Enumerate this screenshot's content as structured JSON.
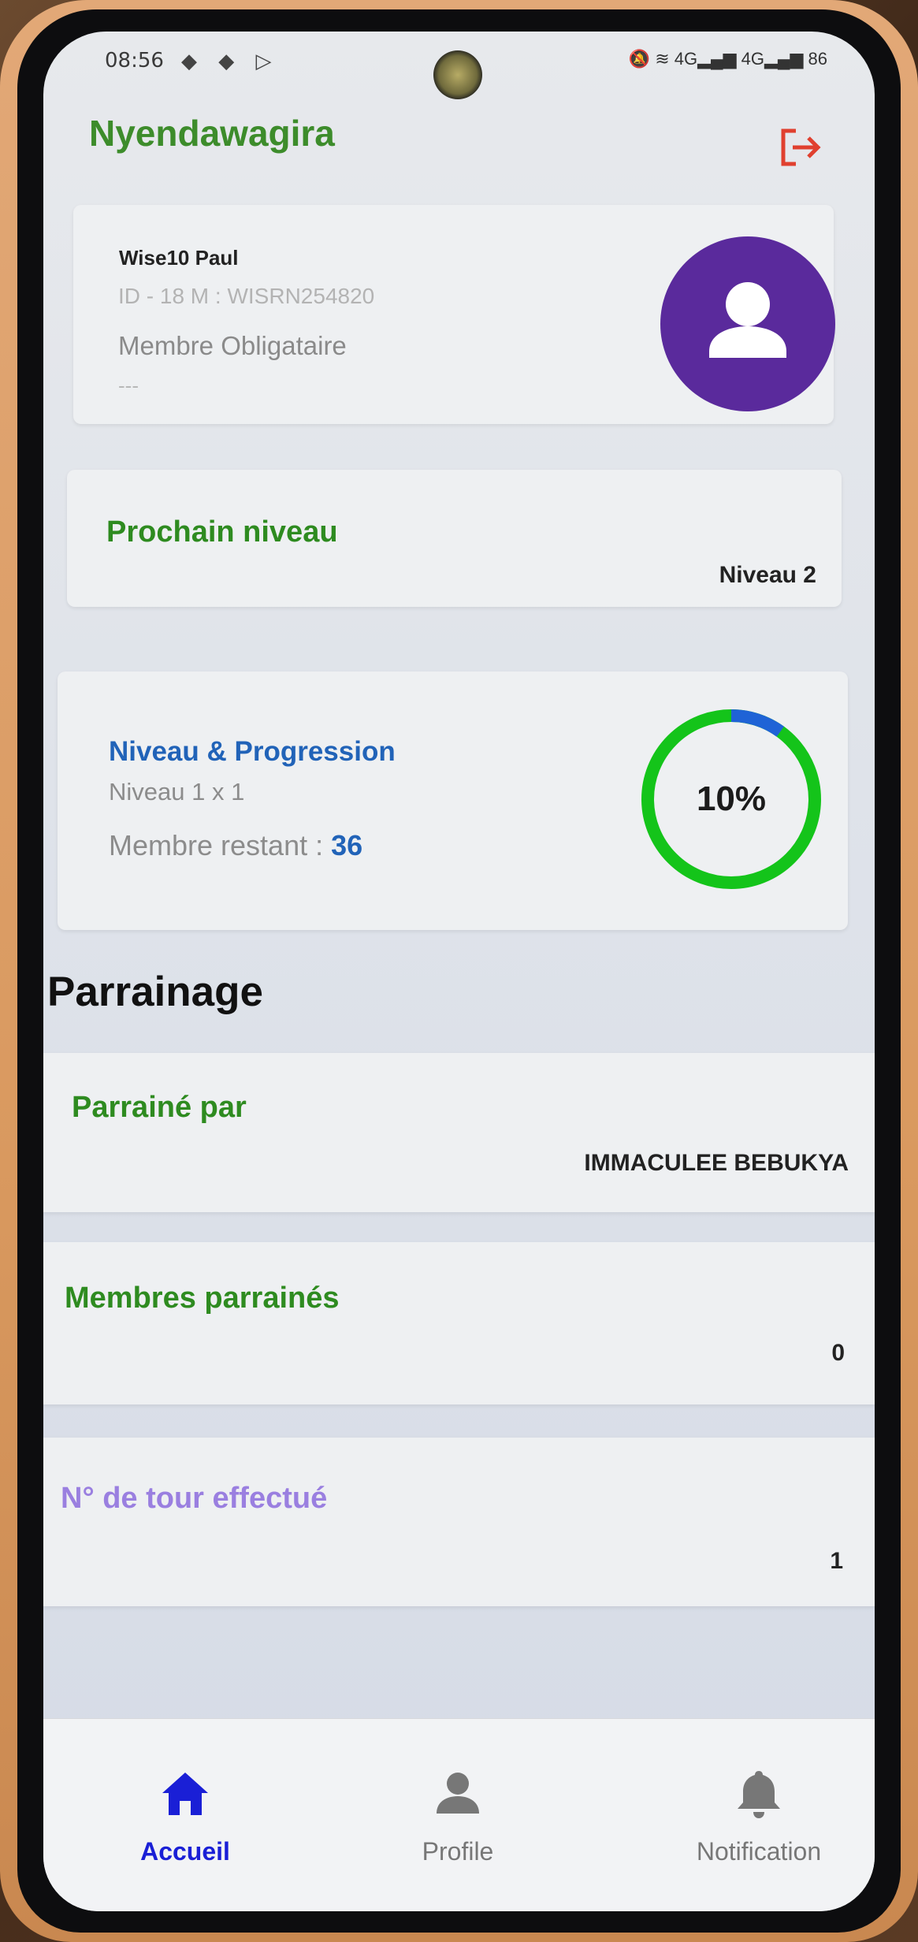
{
  "status_bar": {
    "time": "08:56",
    "left_icons": "◆ ◆ ▷",
    "right_icons": "🔕 ≋ 4G▂▄▆ 4G▂▄▆ 86"
  },
  "app": {
    "title": "Nyendawagira"
  },
  "user_card": {
    "name": "Wise10 Paul",
    "id_line": "ID - 18 M : WISRN254820",
    "role": "Membre Obligataire",
    "extra": "---"
  },
  "next_level_card": {
    "title": "Prochain niveau",
    "value": "Niveau 2"
  },
  "progress_card": {
    "title": "Niveau & Progression",
    "subtitle": "Niveau 1 x 1",
    "remaining_label": "Membre restant : ",
    "remaining_value": "36",
    "percent_text": "10%",
    "percent": 0.1,
    "ring_color": "#14c41a",
    "ring_progress_color": "#1f63d6"
  },
  "section": {
    "heading": "Parrainage"
  },
  "sponsor_card": {
    "title": "Parrainé par",
    "value": "IMMACULEE BEBUKYA"
  },
  "members_card": {
    "title": "Membres parrainés",
    "value": "0"
  },
  "tours_card": {
    "title": "N° de tour effectué",
    "value": "1"
  },
  "bottom_nav": {
    "items": [
      {
        "label": "Accueil",
        "icon": "home-icon",
        "active": true
      },
      {
        "label": "Profile",
        "icon": "person-icon",
        "active": false
      },
      {
        "label": "Notification",
        "icon": "bell-icon",
        "active": false
      }
    ],
    "active_color": "#1a1fd6",
    "inactive_color": "#777777"
  }
}
